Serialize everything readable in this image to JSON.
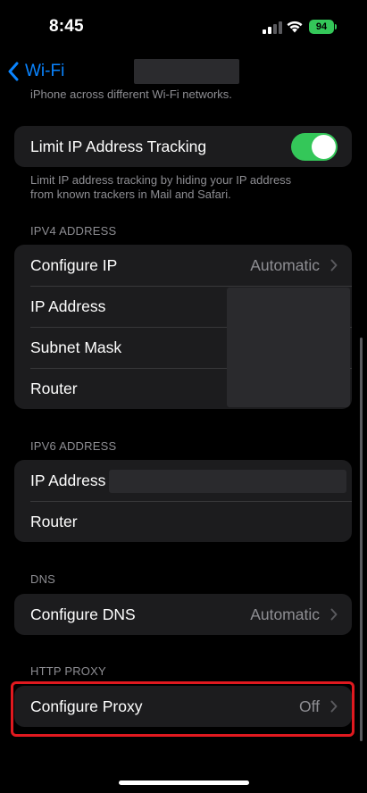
{
  "status_bar": {
    "time": "8:45",
    "battery": "94",
    "battery_color": "#34c759"
  },
  "nav": {
    "back_label": "Wi-Fi",
    "accent": "#0a84ff"
  },
  "top_footnote": "iPhone across different Wi-Fi networks.",
  "limit_ip": {
    "label": "Limit IP Address Tracking",
    "toggle_on": true,
    "footnote_line1": "Limit IP address tracking by hiding your IP address",
    "footnote_line2": "from known trackers in Mail and Safari."
  },
  "ipv4": {
    "header": "IPV4 ADDRESS",
    "configure_ip_label": "Configure IP",
    "configure_ip_value": "Automatic",
    "ip_address_label": "IP Address",
    "subnet_mask_label": "Subnet Mask",
    "router_label": "Router"
  },
  "ipv6": {
    "header": "IPV6 ADDRESS",
    "ip_address_label": "IP Address",
    "router_label": "Router"
  },
  "dns": {
    "header": "DNS",
    "configure_dns_label": "Configure DNS",
    "configure_dns_value": "Automatic"
  },
  "http_proxy": {
    "header": "HTTP PROXY",
    "configure_proxy_label": "Configure Proxy",
    "configure_proxy_value": "Off",
    "highlight_color": "#e0191f"
  }
}
